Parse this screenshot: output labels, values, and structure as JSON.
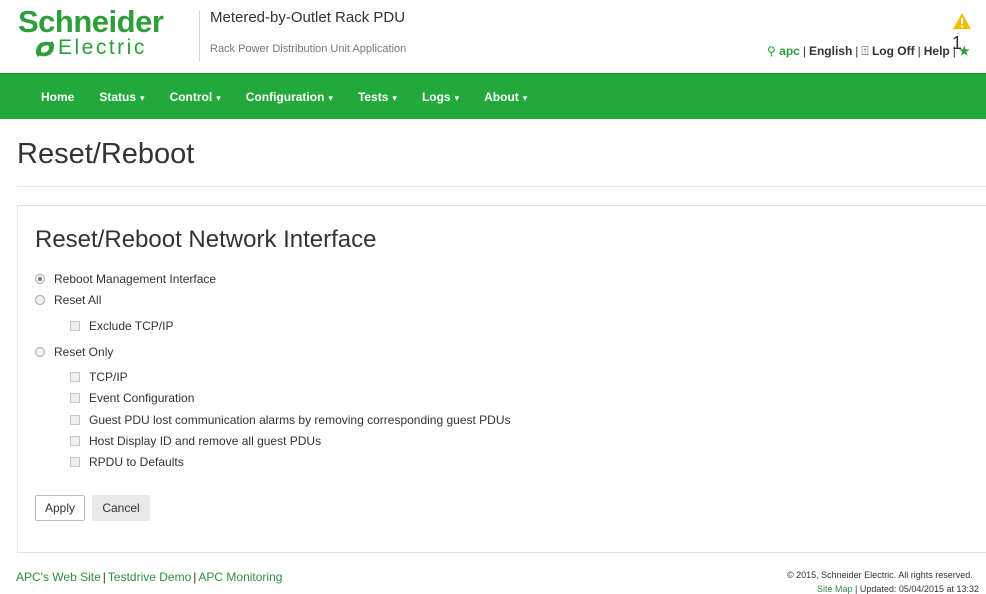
{
  "header": {
    "logo_line1": "Schneider",
    "logo_line2": "Electric",
    "product_name": "Metered-by-Outlet Rack PDU",
    "product_subtitle": "Rack Power Distribution Unit Application",
    "alarm_count": "1",
    "utils": {
      "user": "apc",
      "language": "English",
      "logoff": "Log Off",
      "help": "Help"
    }
  },
  "nav": {
    "items": [
      {
        "label": "Home",
        "dropdown": false
      },
      {
        "label": "Status",
        "dropdown": true
      },
      {
        "label": "Control",
        "dropdown": true
      },
      {
        "label": "Configuration",
        "dropdown": true
      },
      {
        "label": "Tests",
        "dropdown": true
      },
      {
        "label": "Logs",
        "dropdown": true
      },
      {
        "label": "About",
        "dropdown": true
      }
    ],
    "caret": "▾"
  },
  "page": {
    "title": "Reset/Reboot",
    "panel_title": "Reset/Reboot Network Interface",
    "options": {
      "reboot_mgmt": "Reboot Management Interface",
      "reset_all": "Reset All",
      "exclude_tcpip": "Exclude TCP/IP",
      "reset_only": "Reset Only",
      "tcpip": "TCP/IP",
      "event_config": "Event Configuration",
      "guest_pdu_lost": "Guest PDU lost communication alarms by removing corresponding guest PDUs",
      "host_display_id": "Host Display ID and remove all guest PDUs",
      "rpdu_defaults": "RPDU to Defaults"
    },
    "selected_option": "reboot_mgmt",
    "buttons": {
      "apply": "Apply",
      "cancel": "Cancel"
    }
  },
  "footer": {
    "links": [
      "APC's Web Site",
      "Testdrive Demo",
      "APC Monitoring"
    ],
    "copyright": "© 2015, Schneider Electric. All rights reserved.",
    "site_map": "Site Map",
    "updated": "| Updated: 05/04/2015 at 13:32"
  },
  "colors": {
    "brand_green": "#2e9e3b",
    "nav_green": "#21a93b",
    "alarm_yellow": "#f0c000"
  }
}
